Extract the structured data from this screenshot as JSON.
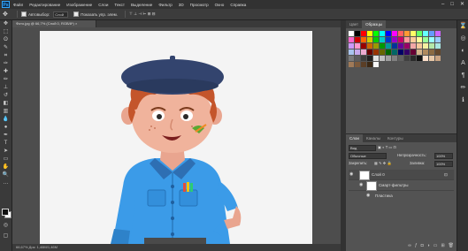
{
  "menu": {
    "logo": "Ps",
    "items": [
      "Файл",
      "Редактирование",
      "Изображение",
      "Слои",
      "Текст",
      "Выделение",
      "Фильтр",
      "3D",
      "Просмотр",
      "Окно",
      "Справка"
    ],
    "window_controls": [
      "–",
      "□",
      "✕"
    ]
  },
  "options": {
    "auto_select_label": "Автовыбор:",
    "auto_select_value": "Слой",
    "show_controls_label": "Показать упр. элем."
  },
  "document": {
    "tab_title": "Фото.jpg @ 66,7% (Слой 0, RGB/8*) ×",
    "status": "66,67%    Док: 1,46M/1,46M"
  },
  "swatches_panel": {
    "tabs": [
      "Цвет",
      "Образцы"
    ],
    "colors": [
      "#ffffff",
      "#000000",
      "#ff0000",
      "#ffff00",
      "#00ff00",
      "#00ffff",
      "#0000ff",
      "#ff00ff",
      "#ff6060",
      "#ff9933",
      "#ffff66",
      "#66ff66",
      "#66ffff",
      "#6699ff",
      "#cc66ff",
      "#ff66cc",
      "#cc0000",
      "#ff6600",
      "#cccc00",
      "#00cc00",
      "#00cccc",
      "#0033cc",
      "#9900cc",
      "#cc0066",
      "#ff9999",
      "#ffcc99",
      "#ffff99",
      "#99ff99",
      "#99ffff",
      "#99ccff",
      "#cc99ff",
      "#ff99cc",
      "#990000",
      "#cc6600",
      "#999900",
      "#009900",
      "#009999",
      "#003399",
      "#660099",
      "#990066",
      "#f2a7a7",
      "#f7c89b",
      "#f5f0a0",
      "#b5e8a8",
      "#a8e5e0",
      "#a9c4ee",
      "#c6a9ec",
      "#ecaad0",
      "#660000",
      "#993300",
      "#666600",
      "#006600",
      "#006666",
      "#000066",
      "#330066",
      "#660033",
      "#d4b48c",
      "#b08a5e",
      "#8a6a42",
      "#64482c",
      "#7a7a7a",
      "#5c5c5c",
      "#3e3e3e",
      "#202020",
      "#e0e0e0",
      "#c0c0c0",
      "#a0a0a0",
      "#808080",
      "#606060",
      "#404040",
      "#2a2a2a",
      "#111111",
      "#ffe0cc",
      "#e8c9a8",
      "#c9a382",
      "#a07a58",
      "#7c5a3c",
      "#5a3e26",
      "#3c2814",
      "#f7f7f7"
    ]
  },
  "layers_panel": {
    "tabs": [
      "Слои",
      "Каналы",
      "Контуры"
    ],
    "kind_label": "Вид",
    "blend_mode": "Обычные",
    "opacity_label": "Непрозрачность:",
    "opacity_value": "100%",
    "lock_label": "Закрепить:",
    "fill_label": "Заливка:",
    "fill_value": "100%",
    "layers": [
      {
        "name": "Слой 0"
      },
      {
        "name": "Смарт-фильтры"
      },
      {
        "name": "Пластика"
      }
    ]
  }
}
